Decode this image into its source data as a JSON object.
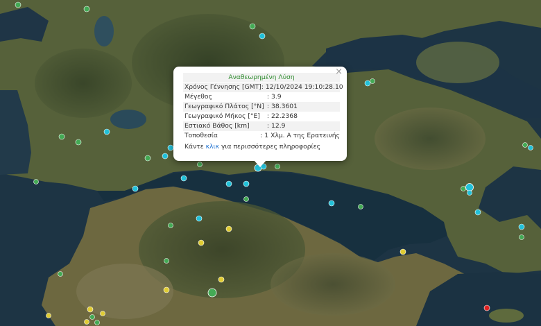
{
  "map": {
    "colors": {
      "sea_deep": "#1d3444",
      "sea_gulf": "#223c4c",
      "land_dark": "#3f4a2c",
      "land_mid": "#5e6a3d",
      "land_light": "#8a845a",
      "marker_green": "#44aa55",
      "marker_cyan": "#22c1d9",
      "marker_yellow": "#e0cc33",
      "marker_red": "#dd2222"
    }
  },
  "popup": {
    "title": "Αναθεωρημένη Λύση",
    "close": "×",
    "rows": [
      {
        "label": "Χρόνος Γέννησης [GMT]",
        "value": "12/10/2024 19:10:28.10"
      },
      {
        "label": "Μέγεθος",
        "value": "3.9"
      },
      {
        "label": "Γεωγραφικό Πλάτος [°N]",
        "value": "38.3601"
      },
      {
        "label": "Γεωγραφικό Μήκος [°E]",
        "value": "22.2368"
      },
      {
        "label": "Εστιακό Βάθος [km]",
        "value": "12.9"
      },
      {
        "label": "Τοποθεσία",
        "value": "1 Χλμ. Α της Ερατεινής"
      }
    ],
    "more_prefix": "Κάντε ",
    "more_link": "κλικ",
    "more_suffix": " για περισσότερες πληροφορίες"
  }
}
